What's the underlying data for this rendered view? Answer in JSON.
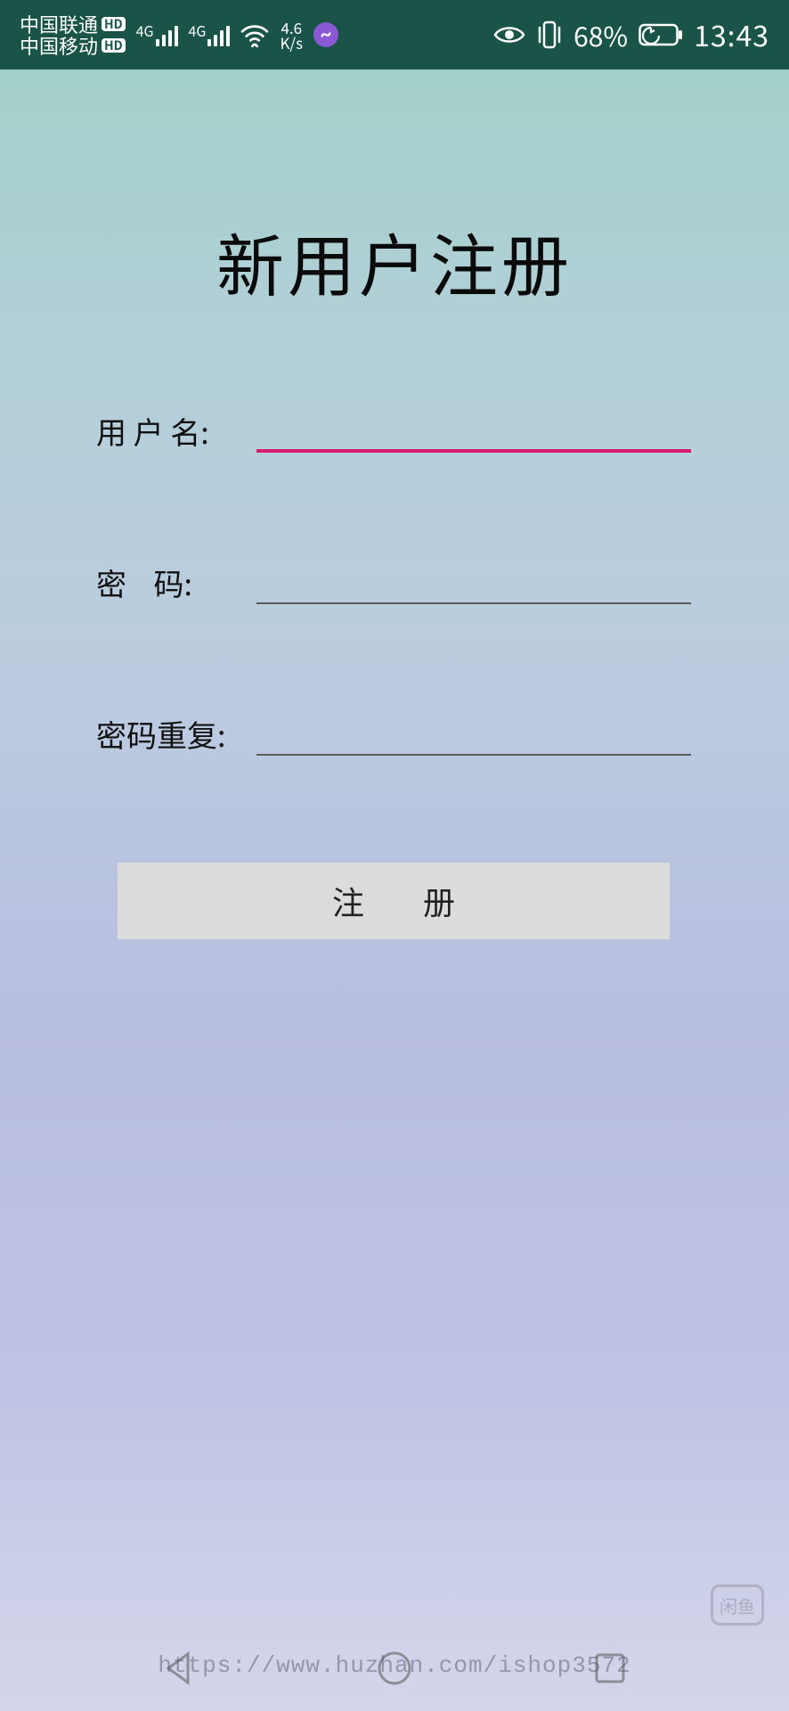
{
  "statusbar": {
    "carriers": [
      "中国联通",
      "中国移动"
    ],
    "hd_badge": "HD",
    "signal_gen": "4G",
    "net_speed_value": "4.6",
    "net_speed_unit": "K/s",
    "battery_pct": "68%",
    "time": "13:43"
  },
  "page": {
    "title": "新用户注册"
  },
  "form": {
    "username_label": "用 户 名:",
    "username_value": "",
    "password_label": "密    码:",
    "password_value": "",
    "password_repeat_label": "密码重复:",
    "password_repeat_value": "",
    "register_button": "注 册"
  },
  "watermark": "https://www.huzhan.com/ishop3572",
  "corner_badge": "闲鱼"
}
